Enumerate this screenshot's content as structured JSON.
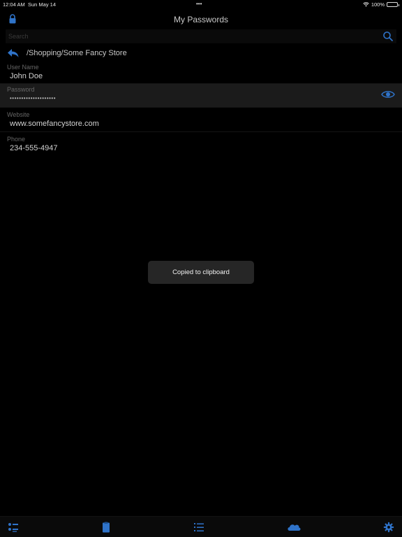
{
  "status_bar": {
    "time": "12:04 AM",
    "date": "Sun May 14",
    "dots": "•••",
    "battery": "100%",
    "battery_level": 1.0
  },
  "nav": {
    "title": "My Passwords",
    "left_icon": "lock-icon"
  },
  "search": {
    "placeholder": "Search",
    "value": "",
    "icon": "search-icon"
  },
  "path": {
    "back_icon": "back-arrow-icon",
    "text": "/Shopping/Some Fancy Store"
  },
  "fields": [
    {
      "label": "User Name",
      "value": "John Doe"
    },
    {
      "label": "Password",
      "value": "••••••••••••••••••••",
      "icon": "eye-icon"
    },
    {
      "label": "Website",
      "value": "www.somefancystore.com"
    },
    {
      "label": "Phone",
      "value": "234-555-4947"
    }
  ],
  "toast": {
    "text": "Copied to clipboard"
  },
  "tab_bar": {
    "items": [
      {
        "icon": "list-icon"
      },
      {
        "icon": "clipboard-icon"
      },
      {
        "icon": "numbered-list-icon"
      },
      {
        "icon": "cloud-icon"
      },
      {
        "icon": "gear-icon"
      }
    ]
  },
  "colors": {
    "accent": "#2f73c9",
    "background": "#000000",
    "highlight_row": "#1b1b1b",
    "toast": "#262626"
  }
}
